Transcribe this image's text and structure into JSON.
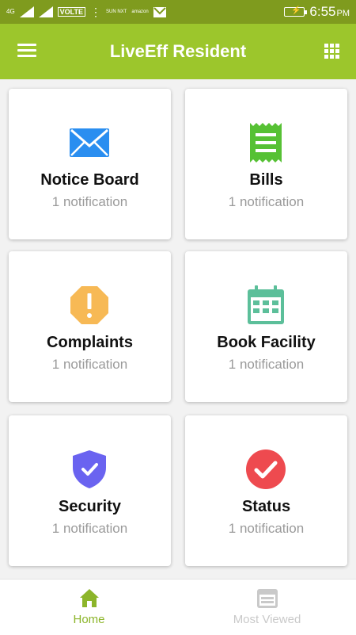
{
  "status_bar": {
    "network": "4G",
    "volte": "VOLTE",
    "app_tags": [
      "SUN NXT",
      "amazon"
    ],
    "time": "6:55",
    "ampm": "PM"
  },
  "header": {
    "title": "LiveEff Resident",
    "menu_icon": "hamburger-icon",
    "apps_icon": "grid-icon",
    "color": "#9cc62c"
  },
  "cards": [
    {
      "label": "Notice Board",
      "sub": "1 notification",
      "icon": "envelope-icon",
      "color": "#2a8ef0"
    },
    {
      "label": "Bills",
      "sub": "1 notification",
      "icon": "receipt-icon",
      "color": "#56c134"
    },
    {
      "label": "Complaints",
      "sub": "1 notification",
      "icon": "warning-octagon-icon",
      "color": "#f7b955"
    },
    {
      "label": "Book Facility",
      "sub": "1 notification",
      "icon": "calendar-icon",
      "color": "#5cbf9a"
    },
    {
      "label": "Security",
      "sub": "1 notification",
      "icon": "shield-check-icon",
      "color": "#6a63f0"
    },
    {
      "label": "Status",
      "sub": "1 notification",
      "icon": "check-circle-icon",
      "color": "#ee4a4f"
    }
  ],
  "bottom_nav": [
    {
      "label": "Home",
      "icon": "home-icon",
      "active": true,
      "color": "#8cb52a"
    },
    {
      "label": "Most Viewed",
      "icon": "window-icon",
      "active": false,
      "color": "#c9c9c9"
    }
  ]
}
